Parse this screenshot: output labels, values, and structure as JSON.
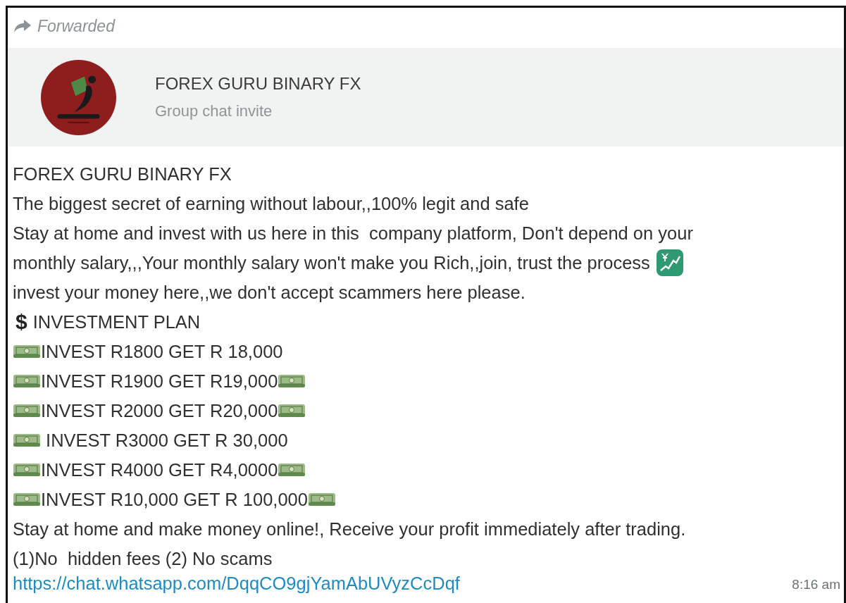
{
  "forwarded": {
    "label": "Forwarded"
  },
  "invite": {
    "title": "FOREX GURU BINARY FX",
    "subtitle": "Group chat invite"
  },
  "message": {
    "lines": [
      [
        {
          "kind": "text",
          "text": "FOREX GURU BINARY FX"
        }
      ],
      [
        {
          "kind": "text",
          "text": "The biggest secret of earning without labour,,100% legit and safe"
        }
      ],
      [
        {
          "kind": "text",
          "text": "Stay at home and invest with us here in this  company platform, Don't depend on your"
        }
      ],
      [
        {
          "kind": "text",
          "text": "monthly salary,,,Your monthly salary won't make you Rich,,join, trust the process"
        },
        {
          "kind": "chart"
        }
      ],
      [
        {
          "kind": "text",
          "text": "invest your money here,,we don't accept scammers here please."
        }
      ],
      [
        {
          "kind": "dollar",
          "text": "$"
        },
        {
          "kind": "text",
          "text": "INVESTMENT PLAN"
        }
      ],
      [
        {
          "kind": "banknote"
        },
        {
          "kind": "text",
          "text": "INVEST R1800 GET R 18,000"
        }
      ],
      [
        {
          "kind": "banknote"
        },
        {
          "kind": "text",
          "text": "INVEST R1900 GET R19,000"
        },
        {
          "kind": "banknote"
        }
      ],
      [
        {
          "kind": "banknote"
        },
        {
          "kind": "text",
          "text": "INVEST R2000 GET R20,000"
        },
        {
          "kind": "banknote"
        }
      ],
      [
        {
          "kind": "banknote"
        },
        {
          "kind": "text",
          "text": " INVEST R3000 GET R 30,000"
        }
      ],
      [
        {
          "kind": "banknote"
        },
        {
          "kind": "text",
          "text": "INVEST R4000 GET R4,0000"
        },
        {
          "kind": "banknote"
        }
      ],
      [
        {
          "kind": "banknote"
        },
        {
          "kind": "text",
          "text": "INVEST R10,000 GET R 100,000"
        },
        {
          "kind": "banknote"
        }
      ],
      [
        {
          "kind": "text",
          "text": "Stay at home and make money online!, Receive your profit immediately after trading."
        }
      ],
      [
        {
          "kind": "text",
          "text": "(1)No  hidden fees (2) No scams"
        }
      ]
    ],
    "link": "https://chat.whatsapp.com/DqqCO9gjYamAbUVyzCcDqf",
    "time": "8:16 am"
  }
}
